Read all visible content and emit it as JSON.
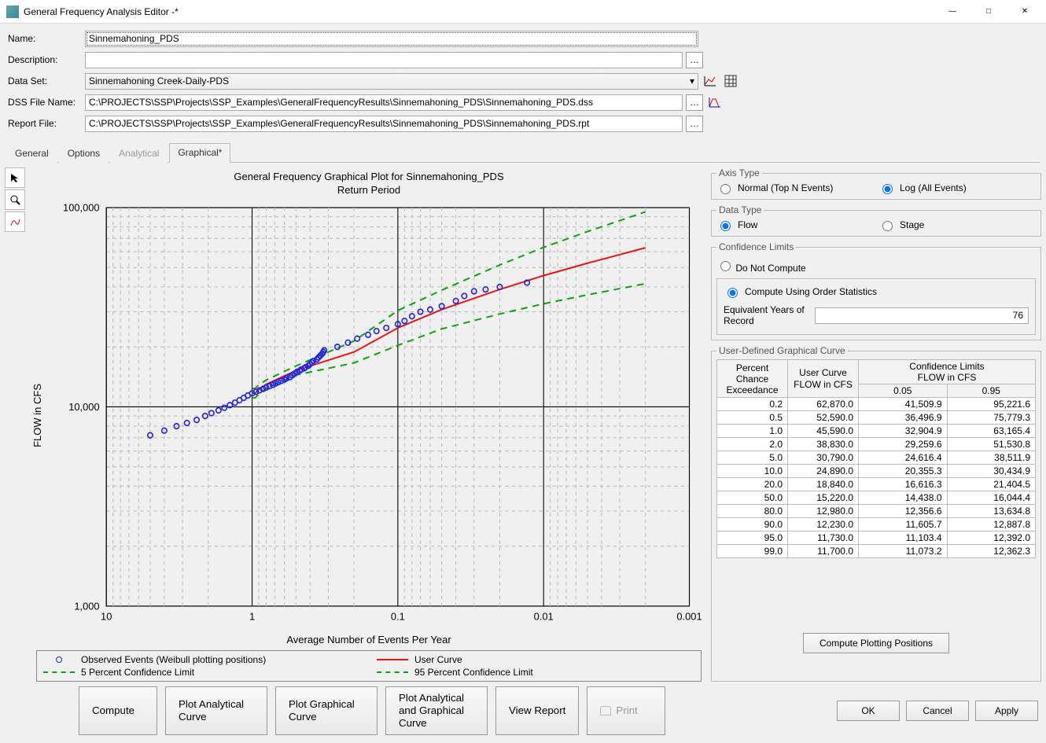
{
  "window": {
    "title": "General Frequency Analysis Editor -*"
  },
  "form": {
    "name_label": "Name:",
    "name_value": "Sinnemahoning_PDS",
    "desc_label": "Description:",
    "desc_value": "",
    "dataset_label": "Data Set:",
    "dataset_value": "Sinnemahoning Creek-Daily-PDS",
    "dss_label": "DSS File Name:",
    "dss_value": "C:\\PROJECTS\\SSP\\Projects\\SSP_Examples\\GeneralFrequencyResults\\Sinnemahoning_PDS\\Sinnemahoning_PDS.dss",
    "report_label": "Report File:",
    "report_value": "C:\\PROJECTS\\SSP\\Projects\\SSP_Examples\\GeneralFrequencyResults\\Sinnemahoning_PDS\\Sinnemahoning_PDS.rpt"
  },
  "tabs": {
    "general": "General",
    "options": "Options",
    "analytical": "Analytical",
    "graphical": "Graphical*"
  },
  "chart": {
    "title": "General Frequency Graphical Plot for Sinnemahoning_PDS",
    "subtitle": "Return Period",
    "xlabel": "Average Number of Events Per Year",
    "ylabel": "FLOW in CFS",
    "legend": {
      "obs": "Observed Events (Weibull plotting positions)",
      "user": "User Curve",
      "ci5": "5 Percent Confidence Limit",
      "ci95": "95 Percent Confidence Limit"
    },
    "yticks": {
      "t100000": "100,000",
      "t10000": "10,000",
      "t1000": "1,000"
    },
    "xticks": {
      "t10": "10",
      "t1": "1",
      "t01": "0.1",
      "t001": "0.01",
      "t0001": "0.001"
    }
  },
  "rhs": {
    "axis_type": {
      "group": "Axis Type",
      "normal": "Normal (Top N Events)",
      "log": "Log (All Events)"
    },
    "data_type": {
      "group": "Data Type",
      "flow": "Flow",
      "stage": "Stage"
    },
    "conf": {
      "group": "Confidence Limits",
      "dnc": "Do Not Compute",
      "order": "Compute Using Order Statistics",
      "eq_label": "Equivalent Years of Record",
      "eq_value": "76"
    },
    "udgc": {
      "group": "User-Defined Graphical Curve",
      "h_percent": "Percent Chance Exceedance",
      "h_user_a": "User Curve",
      "h_user_b": "FLOW in CFS",
      "h_conf_a": "Confidence Limits",
      "h_conf_b": "FLOW in CFS",
      "h_c05": "0.05",
      "h_c95": "0.95",
      "cpp_btn": "Compute Plotting Positions"
    }
  },
  "buttons": {
    "compute": "Compute",
    "plot_an": "Plot Analytical Curve",
    "plot_gr": "Plot Graphical Curve",
    "plot_both": "Plot Analytical and Graphical Curve",
    "view_report": "View Report",
    "print": "Print",
    "ok": "OK",
    "cancel": "Cancel",
    "apply": "Apply"
  },
  "chart_data": {
    "type": "line",
    "title": "General Frequency Graphical Plot for Sinnemahoning_PDS",
    "subtitle": "Return Period",
    "xlabel": "Average Number of Events Per Year",
    "ylabel": "FLOW in CFS",
    "x_axis": {
      "scale": "log",
      "limits": [
        10,
        0.001
      ],
      "ticks": [
        10,
        1,
        0.1,
        0.01,
        0.001
      ],
      "reversed": true
    },
    "y_axis": {
      "scale": "log",
      "limits": [
        1000,
        100000
      ],
      "ticks": [
        1000,
        10000,
        100000
      ]
    },
    "series": [
      {
        "name": "User Curve",
        "style": "solid",
        "color": "#e11",
        "x": [
          0.99,
          0.95,
          0.9,
          0.8,
          0.5,
          0.2,
          0.1,
          0.05,
          0.02,
          0.01,
          0.005,
          0.002
        ],
        "y": [
          11700,
          11730,
          12230,
          12980,
          15220,
          18840,
          24890,
          30790,
          38830,
          45590,
          52590,
          62870
        ]
      },
      {
        "name": "5 Percent Confidence Limit",
        "style": "dashed",
        "color": "#0a0",
        "x": [
          0.99,
          0.95,
          0.9,
          0.8,
          0.5,
          0.2,
          0.1,
          0.05,
          0.02,
          0.01,
          0.005,
          0.002
        ],
        "y": [
          12362.3,
          12392.0,
          12887.8,
          13634.8,
          16044.4,
          21404.5,
          30434.9,
          38511.9,
          51530.8,
          63165.4,
          75779.3,
          95221.6
        ]
      },
      {
        "name": "95 Percent Confidence Limit",
        "style": "dashed",
        "color": "#0a0",
        "x": [
          0.99,
          0.95,
          0.9,
          0.8,
          0.5,
          0.2,
          0.1,
          0.05,
          0.02,
          0.01,
          0.005,
          0.002
        ],
        "y": [
          11073.2,
          11103.4,
          11605.7,
          12356.6,
          14438.0,
          16616.3,
          20355.3,
          24616.4,
          29259.6,
          32904.9,
          36496.9,
          41509.9
        ]
      },
      {
        "name": "Observed Events (Weibull plotting positions)",
        "style": "points",
        "color": "#22e",
        "x": [
          5.0,
          4.0,
          3.3,
          2.8,
          2.4,
          2.1,
          1.9,
          1.7,
          1.55,
          1.42,
          1.31,
          1.22,
          1.14,
          1.07,
          1.0,
          0.94,
          0.89,
          0.84,
          0.8,
          0.76,
          0.72,
          0.69,
          0.66,
          0.63,
          0.6,
          0.58,
          0.55,
          0.53,
          0.51,
          0.49,
          0.47,
          0.46,
          0.44,
          0.43,
          0.41,
          0.4,
          0.39,
          0.38,
          0.36,
          0.35,
          0.34,
          0.33,
          0.325,
          0.32,
          0.26,
          0.22,
          0.19,
          0.16,
          0.14,
          0.12,
          0.1,
          0.09,
          0.08,
          0.07,
          0.06,
          0.05,
          0.04,
          0.035,
          0.03,
          0.025,
          0.02,
          0.013
        ],
        "y": [
          7200,
          7600,
          8000,
          8300,
          8600,
          9000,
          9300,
          9600,
          9900,
          10200,
          10500,
          10800,
          11100,
          11400,
          11700,
          11900,
          12100,
          12300,
          12500,
          12700,
          12900,
          13100,
          13300,
          13500,
          13700,
          13900,
          14100,
          14400,
          14700,
          15000,
          15220,
          15400,
          15600,
          15800,
          16100,
          16400,
          16700,
          17000,
          17300,
          17700,
          18100,
          18500,
          18840,
          19200,
          20000,
          21000,
          22000,
          23000,
          24000,
          24890,
          26000,
          27000,
          28500,
          30000,
          30790,
          32000,
          34000,
          36000,
          38000,
          38830,
          40000,
          42000
        ]
      }
    ],
    "legend_position": "bottom"
  },
  "table_data": [
    {
      "pct": "0.2",
      "user": "62,870.0",
      "c05": "41,509.9",
      "c95": "95,221.6"
    },
    {
      "pct": "0.5",
      "user": "52,590.0",
      "c05": "36,496.9",
      "c95": "75,779.3"
    },
    {
      "pct": "1.0",
      "user": "45,590.0",
      "c05": "32,904.9",
      "c95": "63,165.4"
    },
    {
      "pct": "2.0",
      "user": "38,830.0",
      "c05": "29,259.6",
      "c95": "51,530.8"
    },
    {
      "pct": "5.0",
      "user": "30,790.0",
      "c05": "24,616.4",
      "c95": "38,511.9"
    },
    {
      "pct": "10.0",
      "user": "24,890.0",
      "c05": "20,355.3",
      "c95": "30,434.9"
    },
    {
      "pct": "20.0",
      "user": "18,840.0",
      "c05": "16,616.3",
      "c95": "21,404.5"
    },
    {
      "pct": "50.0",
      "user": "15,220.0",
      "c05": "14,438.0",
      "c95": "16,044.4"
    },
    {
      "pct": "80.0",
      "user": "12,980.0",
      "c05": "12,356.6",
      "c95": "13,634.8"
    },
    {
      "pct": "90.0",
      "user": "12,230.0",
      "c05": "11,605.7",
      "c95": "12,887.8"
    },
    {
      "pct": "95.0",
      "user": "11,730.0",
      "c05": "11,103.4",
      "c95": "12,392.0"
    },
    {
      "pct": "99.0",
      "user": "11,700.0",
      "c05": "11,073.2",
      "c95": "12,362.3"
    }
  ]
}
